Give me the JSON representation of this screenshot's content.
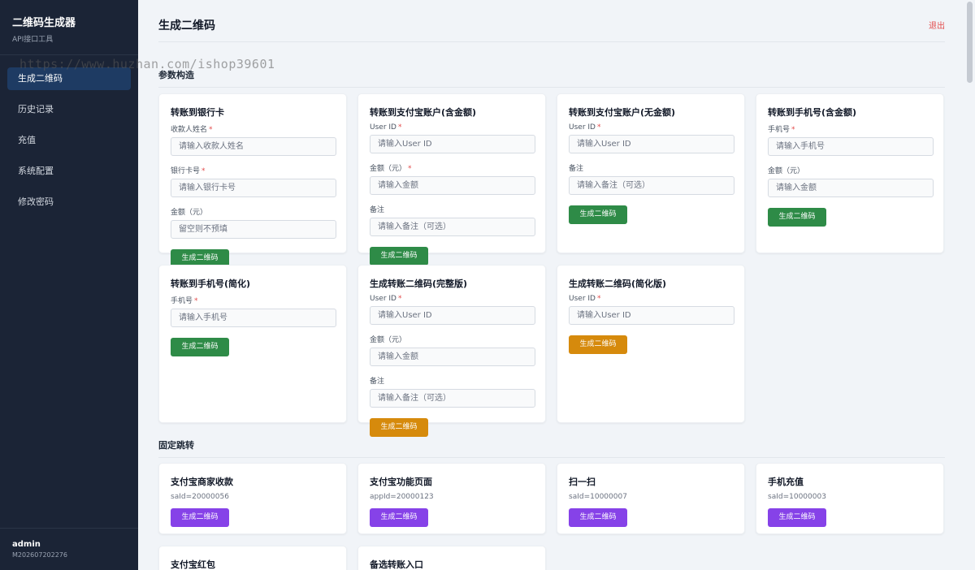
{
  "sidebar": {
    "brand_title": "二维码生成器",
    "brand_sub": "API接口工具",
    "items": [
      {
        "label": "生成二维码"
      },
      {
        "label": "历史记录"
      },
      {
        "label": "充值"
      },
      {
        "label": "系统配置"
      },
      {
        "label": "修改密码"
      }
    ],
    "user_name": "admin",
    "user_id": "M202607202276"
  },
  "header": {
    "title": "生成二维码",
    "logout": "退出"
  },
  "watermark": "https://www.huzhan.com/ishop39601",
  "sections": {
    "params": "参数构造",
    "fixed": "固定跳转"
  },
  "cards": {
    "bank": {
      "title": "转账到银行卡",
      "name_label": "收款人姓名",
      "name_ph": "请输入收款人姓名",
      "card_label": "银行卡号",
      "card_ph": "请输入银行卡号",
      "amount_label": "金额（元）",
      "amount_ph": "留空则不预填",
      "button": "生成二维码"
    },
    "alipay_amount": {
      "title": "转账到支付宝账户(含金额)",
      "uid_label": "User ID",
      "uid_ph": "请输入User ID",
      "amount_label": "金额（元）",
      "amount_ph": "请输入金额",
      "remark_label": "备注",
      "remark_ph": "请输入备注（可选）",
      "button": "生成二维码"
    },
    "alipay_noamount": {
      "title": "转账到支付宝账户(无金额)",
      "uid_label": "User ID",
      "uid_ph": "请输入User ID",
      "remark_label": "备注",
      "remark_ph": "请输入备注（可选）",
      "button": "生成二维码"
    },
    "phone_amount": {
      "title": "转账到手机号(含金额)",
      "phone_label": "手机号",
      "phone_ph": "请输入手机号",
      "amount_label": "金额（元）",
      "amount_ph": "请输入金额",
      "button": "生成二维码"
    },
    "phone_simple": {
      "title": "转账到手机号(简化)",
      "phone_label": "手机号",
      "phone_ph": "请输入手机号",
      "button": "生成二维码"
    },
    "transfer_full": {
      "title": "生成转账二维码(完整版)",
      "uid_label": "User ID",
      "uid_ph": "请输入User ID",
      "amount_label": "金额（元）",
      "amount_ph": "请输入金额",
      "remark_label": "备注",
      "remark_ph": "请输入备注（可选）",
      "button": "生成二维码"
    },
    "transfer_simple": {
      "title": "生成转账二维码(简化版)",
      "uid_label": "User ID",
      "uid_ph": "请输入User ID",
      "button": "生成二维码"
    }
  },
  "fixed": [
    {
      "title": "支付宝商家收款",
      "sub": "saId=20000056",
      "button": "生成二维码"
    },
    {
      "title": "支付宝功能页面",
      "sub": "appId=20000123",
      "button": "生成二维码"
    },
    {
      "title": "扫一扫",
      "sub": "saId=10000007",
      "button": "生成二维码"
    },
    {
      "title": "手机充值",
      "sub": "saId=10000003",
      "button": "生成二维码"
    },
    {
      "title": "支付宝红包"
    },
    {
      "title": "备选转账入口"
    }
  ],
  "colors": {
    "sidebar_bg": "#1b2436",
    "active_nav": "#1e3b63",
    "green": "#2e8b47",
    "orange": "#d68a0c",
    "purple": "#8642e8",
    "danger": "#e34b4b"
  }
}
